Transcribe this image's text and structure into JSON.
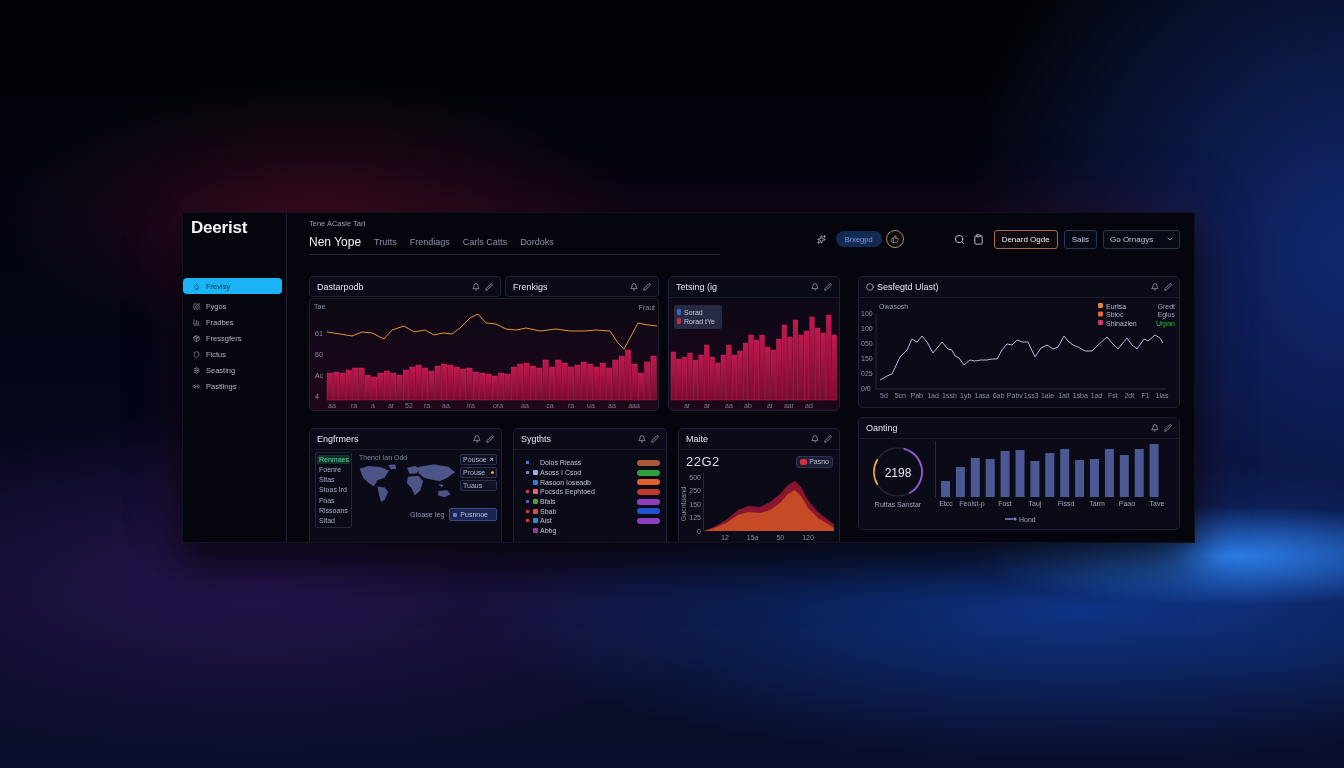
{
  "app": {
    "logo": "Deerist"
  },
  "sidebar": {
    "items": [
      {
        "label": "Frevisy",
        "selected": true
      },
      {
        "label": "Fygos",
        "selected": false
      },
      {
        "label": "Fradbes",
        "selected": false
      },
      {
        "label": "Fressgfers",
        "selected": false
      },
      {
        "label": "Fictus",
        "selected": false
      },
      {
        "label": "Seasting",
        "selected": false
      },
      {
        "label": "Pastlings",
        "selected": false
      }
    ]
  },
  "header": {
    "breadcrumb": "Tene ACasle Tarl",
    "tabs": [
      {
        "label": "Nen Yope",
        "selected": true
      },
      {
        "label": "Trutts",
        "selected": false
      },
      {
        "label": "Frendiags",
        "selected": false
      },
      {
        "label": "Carls Catts",
        "selected": false
      },
      {
        "label": "Dordoks",
        "selected": false
      }
    ],
    "status_pill": "Brxegpd",
    "buttons": [
      {
        "label": "Denard Ogde",
        "kind": "accent"
      },
      {
        "label": "Salis",
        "kind": "plain"
      }
    ],
    "dropdown": {
      "value": "Go Ornagys"
    }
  },
  "combo_chart_card": {
    "titles": [
      "Dastarpodb",
      "Frenkigs"
    ],
    "axis_title": "Tae",
    "corner_label": "Fraut",
    "y_ticks": [
      "61",
      "60",
      "Ac",
      "4"
    ],
    "x_ticks": [
      "aa",
      "ra",
      "a",
      "ar",
      "52",
      "ra",
      "aa",
      "ira",
      "ora",
      "aa",
      "ca",
      "ra",
      "ua",
      "aa",
      "aaa"
    ]
  },
  "bar_chart_card": {
    "title": "Tetsing (ig",
    "legend": [
      {
        "label": "Sorad",
        "color": "#3a62c6"
      },
      {
        "label": "Rorad tYe",
        "color": "#c42a44"
      }
    ],
    "x_ticks": [
      "ar",
      "ar",
      "aa",
      "ab",
      "ar",
      "aar",
      "ad"
    ]
  },
  "line_chart_card": {
    "title": "Sesfegtd Ulast)",
    "axis_title": "Owasosh",
    "y_ticks": [
      "100",
      "100",
      "050",
      "150",
      "025",
      "0/0"
    ],
    "x_ticks": [
      "5d",
      "5cn",
      "Pab",
      "1ad",
      "1ssb",
      "1yb",
      "1asa",
      "6ab",
      "Pabv",
      "1ss3",
      "1ale",
      "1ait",
      "1sba",
      "1ad",
      "Fst",
      "2dt",
      "F1",
      "1ias"
    ],
    "legend": [
      {
        "label": "Eurtsa",
        "value": "Gredt",
        "color": "#e0843a",
        "highlighted": false
      },
      {
        "label": "Sbloc",
        "value": "Eglos",
        "color": "#e0683a",
        "highlighted": false
      },
      {
        "label": "Shinazien",
        "value": "Urpnn",
        "color": "#d03a6a",
        "highlighted": true
      }
    ]
  },
  "map_card": {
    "title": "Engfrmers",
    "map_title": "Thenct Ian Odd",
    "regions": [
      {
        "label": "Renmaes",
        "selected": true
      },
      {
        "label": "Foenre",
        "selected": false
      },
      {
        "label": "Sitas",
        "selected": false
      },
      {
        "label": "Stoas Ird",
        "selected": false
      },
      {
        "label": "Fnas",
        "selected": false
      },
      {
        "label": "Rissoans",
        "selected": false
      },
      {
        "label": "Sifad",
        "selected": false
      }
    ],
    "filters": [
      {
        "label": "Pousoe",
        "kind": "arrow"
      },
      {
        "label": "Prouse",
        "kind": "dot"
      },
      {
        "label": "Tuaus",
        "kind": "plain"
      }
    ],
    "footer_label": "Gtoase Ieg",
    "action": "Pusnnoe"
  },
  "list_card": {
    "title": "Sygthts",
    "items": [
      {
        "label": "Dolos Rieass",
        "bullet": {
          "color": "#5a72c4"
        },
        "tag": {
          "color": "#a8583a"
        }
      },
      {
        "label": "Asoss I Csod",
        "bullet": {
          "color": "#6a82c8"
        },
        "color": "#8eb4e6",
        "tag": {
          "color": "#2f9e3e"
        }
      },
      {
        "label": "Rasoon Ioseadb",
        "color": "#2f7fd6",
        "tag": {
          "color": "#e0602a"
        }
      },
      {
        "label": "Pocsds Eephtoed",
        "bullet": {
          "color": "#d04040"
        },
        "color": "#e0607e",
        "tag": {
          "color": "#c0392f"
        }
      },
      {
        "label": "Bfals",
        "bullet": {
          "color": "#5060c4"
        },
        "color": "#4e9e3a",
        "tag": {
          "color": "#8e3fc0"
        }
      },
      {
        "label": "Sbab",
        "bullet": {
          "color": "#d04040"
        },
        "color": "#e04848",
        "tag": {
          "color": "#2352d0"
        }
      },
      {
        "label": "Aist",
        "bullet": {
          "color": "#d04040"
        },
        "color": "#2f8fd6",
        "tag": {
          "color": "#8a3ec2"
        }
      },
      {
        "label": "Abbg",
        "color": "#a0389e"
      }
    ]
  },
  "area_chart_card": {
    "title": "Maite",
    "value": "22G2",
    "badge": "Pasno",
    "axis_title": "Gucntuand",
    "y_ticks": [
      "500",
      "250",
      "150",
      "125",
      "0"
    ],
    "x_ticks": [
      "12",
      "15a",
      "50",
      "120"
    ]
  },
  "gauge_card": {
    "title": "Oanting",
    "gauge_value": "2198",
    "gauge_label": "Ruttas Sanstar",
    "x_labels": [
      "Etcc",
      "Feolst-p",
      "Fost",
      "Tauj",
      "Fissd",
      "Tarm",
      "Paao",
      "Tave"
    ],
    "legend": "Hond"
  }
}
